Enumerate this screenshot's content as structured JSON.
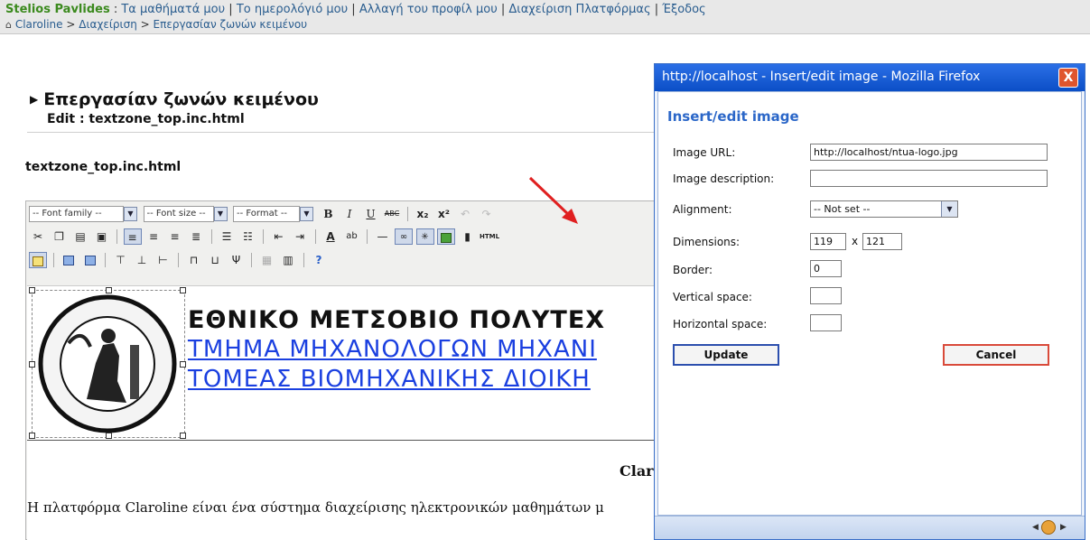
{
  "userbar": {
    "user_name": "Stelios Pavlides",
    "links": [
      "Τα μαθήματά μου",
      "Το ημερολόγιό μου",
      "Αλλαγή του προφίλ μου",
      "Διαχείριση Πλατφόρμας",
      "Έξοδος"
    ],
    "breadcrumb": [
      "Claroline",
      "Διαχείριση",
      "Επεργασίαν ζωνών κειμένου"
    ]
  },
  "page": {
    "title": "Επεργασίαν ζωνών κειμένου",
    "subtitle": "Edit : textzone_top.inc.html",
    "file_name": "textzone_top.inc.html"
  },
  "editor": {
    "font_family": "-- Font family --",
    "font_size": "-- Font size --",
    "format": "-- Format --",
    "html_label": "HTML",
    "heading1": "ΕΘΝΙΚΟ ΜΕΤΣΟΒΙΟ ΠΟΛΥΤΕΧ",
    "heading2": "ΤΜΗΜΑ ΜΗΧΑΝΟΛΟΓΩΝ ΜΗΧΑΝΙ",
    "heading3": "ΤΟΜΕΑΣ ΒΙΟΜΗΧΑΝΙΚΗΣ ΔΙΟΙΚΗ",
    "center_text": "Clar",
    "paragraph": "Η πλατφόρμα Claroline είναι ένα σύστημα διαχείρισης ηλεκτρονικών μαθημάτων μ"
  },
  "popup": {
    "window_title": "http://localhost - Insert/edit image - Mozilla Firefox",
    "heading": "Insert/edit image",
    "labels": {
      "image_url": "Image URL:",
      "image_description": "Image description:",
      "alignment": "Alignment:",
      "dimensions": "Dimensions:",
      "border": "Border:",
      "vspace": "Vertical space:",
      "hspace": "Horizontal space:"
    },
    "values": {
      "image_url": "http://localhost/ntua-logo.jpg",
      "image_description": "",
      "alignment": "-- Not set --",
      "width": "119",
      "times": "x",
      "height": "121",
      "border": "0",
      "vspace": "",
      "hspace": ""
    },
    "update_label": "Update",
    "cancel_label": "Cancel",
    "close_label": "X"
  },
  "colors": {
    "link": "#2a5d8f",
    "user_name": "#3b8a1e",
    "heading_blue": "#1a3fe0",
    "titlebar": "#0b4ec6",
    "arrow_red": "#e02020"
  }
}
